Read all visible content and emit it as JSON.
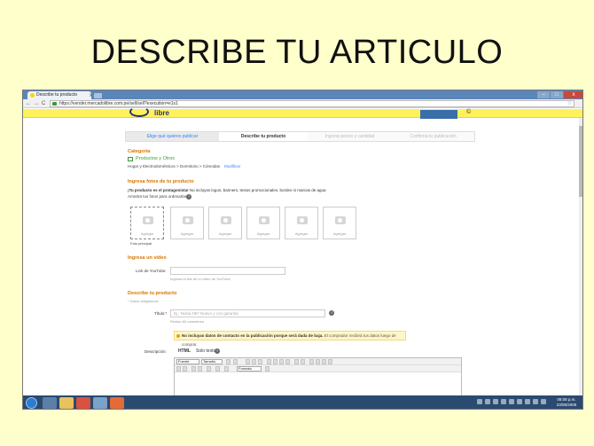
{
  "slide": {
    "title": "DESCRIBE TU ARTICULO"
  },
  "browser": {
    "tab_title": "Describe tu producto",
    "tab_close": "x",
    "url": "https://vender.mercadolibre.com.pe/sell/sell?execution=e1s1",
    "nav_back": "←",
    "nav_forward": "→",
    "nav_reload": "C",
    "star": "☆",
    "win_min": "–",
    "win_max": "□",
    "win_close": "x"
  },
  "site": {
    "logo_text": "libre",
    "user_icon": "©"
  },
  "steps": [
    {
      "label": "Elige qué quieres publicar"
    },
    {
      "label": "Describe tu producto"
    },
    {
      "label": "Ingresa precio y cantidad"
    },
    {
      "label": "Confirma tu publicación"
    }
  ],
  "category": {
    "heading": "Categoría",
    "name": "Productos y Otros",
    "path": "Hogar y Electrodomésticos  >  Dormitorio  >  Cómodas",
    "modify_link": "Modificar"
  },
  "photos": {
    "heading": "Ingresa fotos de tu producto",
    "note_bold": "¡Tu producto es el protagonista!",
    "note_rest": " No incluyas logos, banners, textos promocionales, bordes ni marcas de agua",
    "order_note": "Arrastra tus fotos para ordenarlas.",
    "help": "?",
    "add_label": "Agregar",
    "main_caption": "Foto principal"
  },
  "video": {
    "heading": "Ingresa un video",
    "field_label": "Link de YouTube:",
    "hint": "Ingresa el link de tu video de YouTube"
  },
  "describe": {
    "heading": "Describe tu producto",
    "required_note": "* Datos obligatorios",
    "title_label": "Título:",
    "title_req": "*",
    "title_placeholder": "Ej.: Nokia N97 Nuevo y con garantía",
    "title_help": "?",
    "title_counter": "Restan 60 caracteres",
    "notice_bold": "No incluyas datos de contacto en la publicación porque será dada de baja.",
    "notice_rest": " El comprador recibirá tus datos luego de comprar.",
    "description_label": "Descripción:",
    "tab_html": "HTML",
    "tab_text": "Solo texto",
    "tab_help": "?",
    "font_family": "Fuente",
    "font_size": "Tamaño",
    "format": "Formato"
  },
  "taskbar": {
    "time": "08:08 p.m.",
    "date": "23/05/2005"
  }
}
